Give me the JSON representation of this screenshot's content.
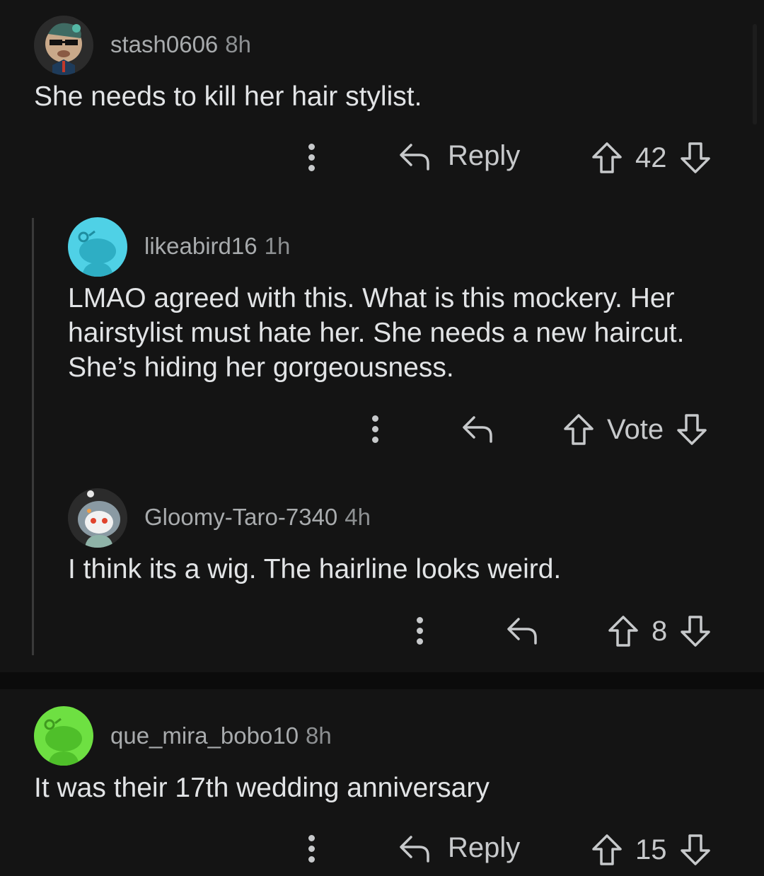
{
  "comments": [
    {
      "username": "stash0606",
      "time": "8h",
      "text": "She needs to kill her hair stylist.",
      "reply_label": "Reply",
      "score": "42"
    },
    {
      "username": "likeabird16",
      "time": "1h",
      "text_lines": [
        "LMAO agreed with this. What is this mockery. Her",
        "hairstylist must hate her. She needs a new haircut.",
        "She’s hiding her gorgeousness."
      ],
      "score": "Vote"
    },
    {
      "username": "Gloomy-Taro-7340",
      "time": "4h",
      "text": "I think its a wig. The hairline looks weird.",
      "score": "8"
    },
    {
      "username": "que_mira_bobo10",
      "time": "8h",
      "text": "It was their 17th wedding anniversary",
      "reply_label": "Reply",
      "score": "15"
    }
  ],
  "colors": {
    "background": "#141414",
    "avatar_cyan": "#4fd1e6",
    "avatar_green": "#6ee042",
    "avatar_dark": "#2b2b2b"
  }
}
